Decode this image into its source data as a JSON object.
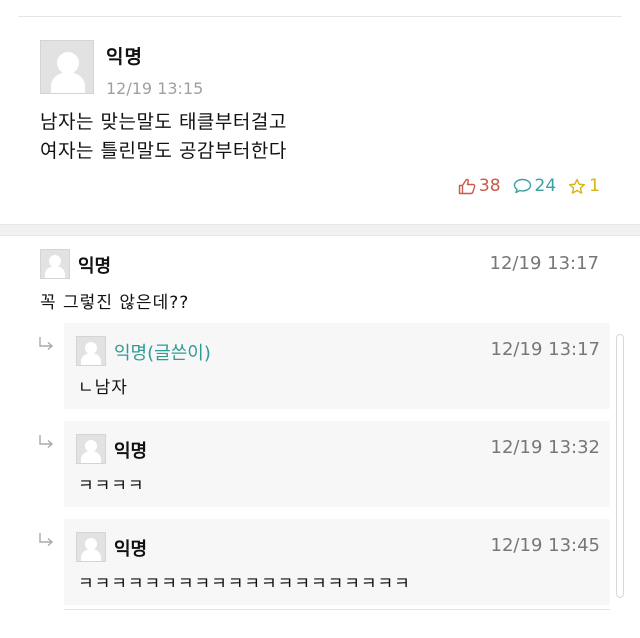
{
  "post": {
    "author": "익명",
    "timestamp": "12/19 13:15",
    "body_lines": [
      "남자는 맞는말도 태클부터걸고",
      "여자는 틀린말도 공감부터한다"
    ],
    "likes": "38",
    "comments": "24",
    "scraps": "1"
  },
  "comments": [
    {
      "author": "익명",
      "timestamp": "12/19 13:17",
      "text": "꼭 그렇진 않은데??"
    }
  ],
  "replies": [
    {
      "author": "익명(글쓴이)",
      "timestamp": "12/19 13:17",
      "text": "ㄴ남자",
      "is_op": true
    },
    {
      "author": "익명",
      "timestamp": "12/19 13:32",
      "text": "ㅋㅋㅋㅋ",
      "is_op": false
    },
    {
      "author": "익명",
      "timestamp": "12/19 13:45",
      "text": "ㅋㅋㅋㅋㅋㅋㅋㅋㅋㅋㅋㅋㅋㅋㅋㅋㅋㅋㅋㅋ",
      "is_op": false
    }
  ],
  "colors": {
    "like": "#c9594a",
    "comment": "#3aa0a0",
    "scrap": "#d8b312",
    "op_name": "#2f9b95"
  },
  "icons": {
    "like": "thumbs-up-icon",
    "comment": "speech-bubble-icon",
    "scrap": "star-icon",
    "reply": "reply-arrow-icon",
    "avatar": "default-avatar-icon"
  }
}
